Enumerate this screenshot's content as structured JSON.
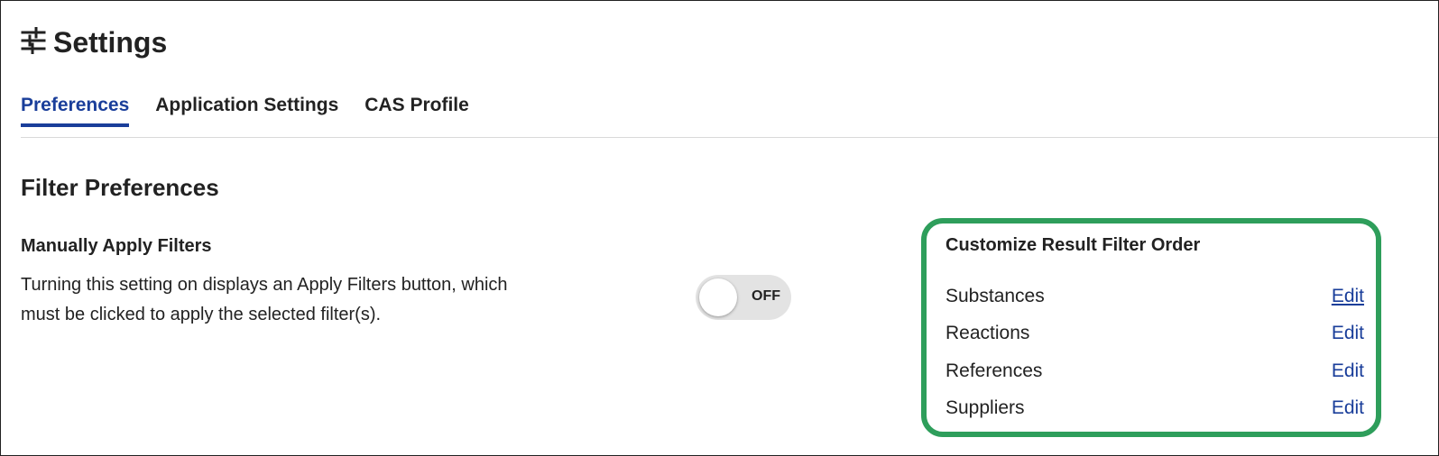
{
  "header": {
    "title": "Settings",
    "icon": "sliders-icon"
  },
  "tabs": [
    {
      "label": "Preferences",
      "active": true
    },
    {
      "label": "Application Settings",
      "active": false
    },
    {
      "label": "CAS Profile",
      "active": false
    }
  ],
  "filter_preferences": {
    "title": "Filter Preferences",
    "manual_apply": {
      "title": "Manually Apply Filters",
      "description": "Turning this setting on displays an Apply Filters button, which must be clicked to apply the selected filter(s).",
      "toggle_label": "OFF",
      "toggle_on": false
    },
    "customize_order": {
      "title": "Customize Result Filter Order",
      "items": [
        {
          "label": "Substances",
          "action": "Edit"
        },
        {
          "label": "Reactions",
          "action": "Edit"
        },
        {
          "label": "References",
          "action": "Edit"
        },
        {
          "label": "Suppliers",
          "action": "Edit"
        }
      ]
    }
  },
  "colors": {
    "accent": "#1a3e9a",
    "highlight": "#2e9e5b",
    "toggle_bg": "#e3e3e3"
  }
}
